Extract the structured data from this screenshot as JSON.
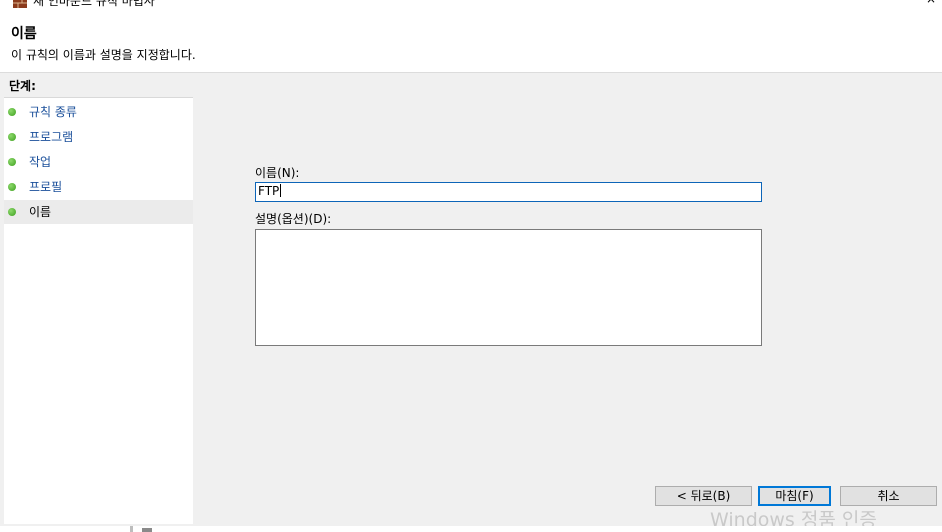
{
  "window": {
    "title": "새 인바운드 규칙 마법사",
    "close_glyph": "×"
  },
  "header": {
    "title": "이름",
    "subtitle": "이 규칙의 이름과 설명을 지정합니다."
  },
  "steps": {
    "heading": "단계:",
    "items": [
      {
        "label": "규칙 종류",
        "active": false
      },
      {
        "label": "프로그램",
        "active": false
      },
      {
        "label": "작업",
        "active": false
      },
      {
        "label": "프로필",
        "active": false
      },
      {
        "label": "이름",
        "active": true
      }
    ]
  },
  "form": {
    "name_label": "이름(N):",
    "name_value": "FTP",
    "description_label": "설명(옵션)(D):",
    "description_value": ""
  },
  "buttons": {
    "back": "< 뒤로(B)",
    "finish": "마침(F)",
    "cancel": "취소"
  },
  "watermark": "Windows 정품 인증",
  "colors": {
    "accent": "#0078d7",
    "step_link": "#1a4f9a",
    "step_dot": "#3d9f1f",
    "panel_bg": "#f0f0f0"
  },
  "icons": {
    "app": "firewall-wall-icon",
    "step_bullet": "green-dot-icon"
  }
}
